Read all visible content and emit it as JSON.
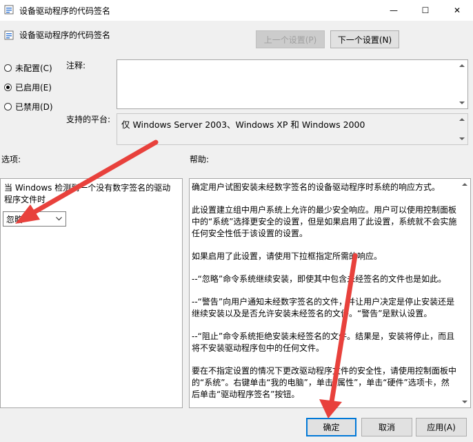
{
  "window": {
    "title": "设备驱动程序的代码签名",
    "min_glyph": "—",
    "max_glyph": "☐",
    "close_glyph": "✕"
  },
  "header": {
    "title": "设备驱动程序的代码签名",
    "prev_button": "上一个设置(P)",
    "next_button": "下一个设置(N)"
  },
  "radios": [
    {
      "label": "未配置(C)",
      "selected": false
    },
    {
      "label": "已启用(E)",
      "selected": true
    },
    {
      "label": "已禁用(D)",
      "selected": false
    }
  ],
  "comment": {
    "label": "注释:",
    "value": ""
  },
  "platform": {
    "label": "支持的平台:",
    "value": "仅 Windows Server 2003、Windows XP 和 Windows 2000"
  },
  "options": {
    "label": "选项:",
    "description": "当 Windows 检测到一个没有数字签名的驱动程序文件时",
    "selected_value": "忽略"
  },
  "help": {
    "label": "帮助:",
    "paragraphs": [
      "确定用户试图安装未经数字签名的设备驱动程序时系统的响应方式。",
      "此设置建立组中用户系统上允许的最少安全响应。用户可以使用控制面板中的“系统”选择更安全的设置，但是如果启用了此设置，系统就不会实施任何安全性低于该设置的设置。",
      "如果启用了此设置，请使用下拉框指定所需的响应。",
      "--“忽略”命令系统继续安装，即使其中包含未经签名的文件也是如此。",
      "--“警告”向用户通知未经数字签名的文件，并让用户决定是停止安装还是继续安装以及是否允许安装未经签名的文件。“警告”是默认设置。",
      "--“阻止”命令系统拒绝安装未经签名的文件。结果是，安装将停止，而且将不安装驱动程序包中的任何文件。",
      "要在不指定设置的情况下更改驱动程序文件的安全性，请使用控制面板中的“系统”。右键单击“我的电脑”，单击“属性”，单击“硬件”选项卡，然后单击“驱动程序签名”按钮。"
    ]
  },
  "footer": {
    "ok": "确定",
    "cancel": "取消",
    "apply": "应用(A)"
  },
  "colors": {
    "accent": "#0078d7",
    "annotation_arrow": "#e8413c"
  }
}
